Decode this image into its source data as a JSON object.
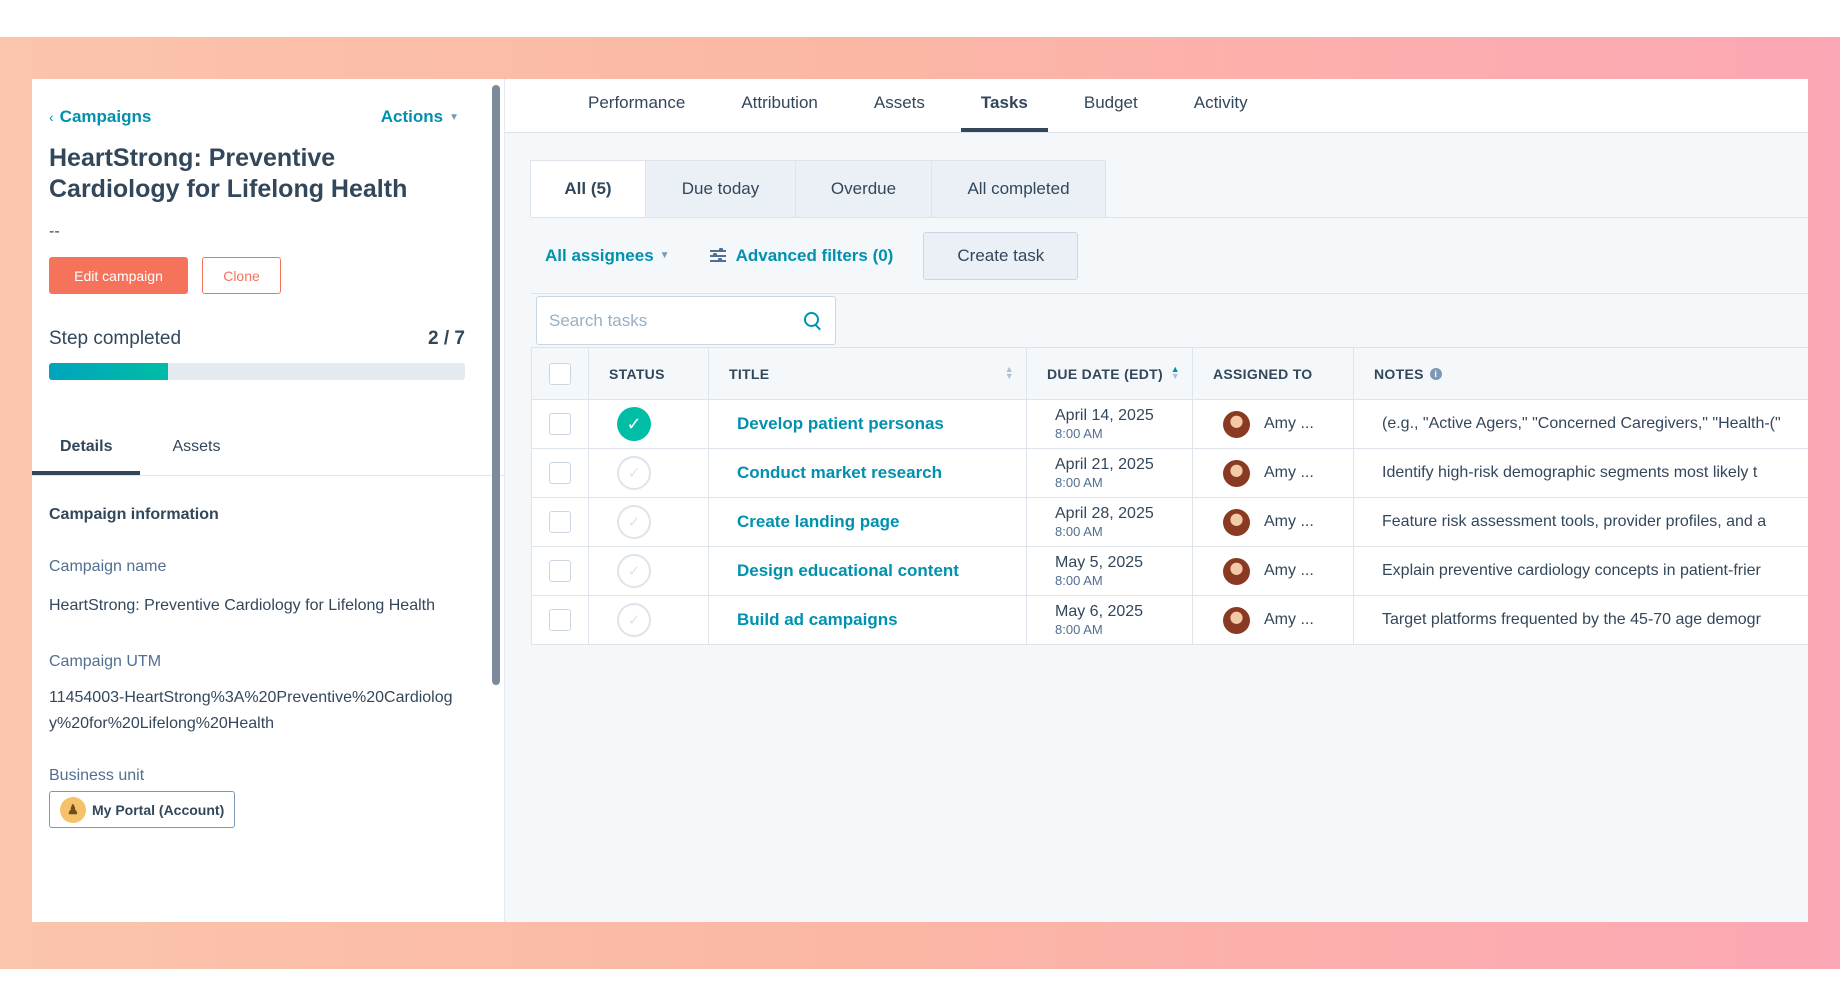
{
  "left_panel": {
    "breadcrumb": "Campaigns",
    "actions_label": "Actions",
    "campaign_title": "HeartStrong: Preventive Cardiology for Lifelong Health",
    "description": "--",
    "edit_button": "Edit campaign",
    "clone_button": "Clone",
    "step_label": "Step completed",
    "step_count": "2 / 7",
    "step_progress_fraction": 0.2857,
    "tabs": [
      {
        "label": "Details",
        "active": true
      },
      {
        "label": "Assets",
        "active": false
      }
    ],
    "section_title": "Campaign information",
    "fields": {
      "name_label": "Campaign name",
      "name_value": "HeartStrong: Preventive Cardiology for Lifelong Health",
      "utm_label": "Campaign UTM",
      "utm_value": "11454003-HeartStrong%3A%20Preventive%20Cardiology%20for%20Lifelong%20Health",
      "business_unit_label": "Business unit",
      "business_unit_value": "My Portal (Account)"
    }
  },
  "top_tabs": [
    {
      "label": "Performance",
      "active": false
    },
    {
      "label": "Attribution",
      "active": false
    },
    {
      "label": "Assets",
      "active": false
    },
    {
      "label": "Tasks",
      "active": true
    },
    {
      "label": "Budget",
      "active": false
    },
    {
      "label": "Activity",
      "active": false
    }
  ],
  "sub_tabs": [
    {
      "label": "All (5)",
      "active": true
    },
    {
      "label": "Due today",
      "active": false
    },
    {
      "label": "Overdue",
      "active": false
    },
    {
      "label": "All completed",
      "active": false
    }
  ],
  "filters": {
    "assignees": "All assignees",
    "advanced": "Advanced filters (0)",
    "create_task": "Create task"
  },
  "search": {
    "placeholder": "Search tasks"
  },
  "table": {
    "headers": {
      "status": "STATUS",
      "title": "TITLE",
      "due_date": "DUE DATE (EDT)",
      "assigned_to": "ASSIGNED TO",
      "notes": "NOTES"
    },
    "rows": [
      {
        "completed": true,
        "title": "Develop patient personas",
        "due_date": "April 14, 2025",
        "due_time": "8:00 AM",
        "assignee": "Amy ...",
        "notes": "(e.g., \"Active Agers,\" \"Concerned Caregivers,\" \"Health-(\""
      },
      {
        "completed": false,
        "title": "Conduct market research",
        "due_date": "April 21, 2025",
        "due_time": "8:00 AM",
        "assignee": "Amy ...",
        "notes": "Identify high-risk demographic segments most likely t"
      },
      {
        "completed": false,
        "title": "Create landing page",
        "due_date": "April 28, 2025",
        "due_time": "8:00 AM",
        "assignee": "Amy ...",
        "notes": "Feature risk assessment tools, provider profiles, and a"
      },
      {
        "completed": false,
        "title": "Design educational content",
        "due_date": "May 5, 2025",
        "due_time": "8:00 AM",
        "assignee": "Amy ...",
        "notes": "Explain preventive cardiology concepts in patient-frier"
      },
      {
        "completed": false,
        "title": "Build ad campaigns",
        "due_date": "May 6, 2025",
        "due_time": "8:00 AM",
        "assignee": "Amy ...",
        "notes": "Target platforms frequented by the 45-70 age demogr"
      }
    ]
  },
  "colors": {
    "accent": "#0091ae",
    "primary_button": "#f5725b",
    "completed": "#00bda5",
    "text": "#33475b"
  }
}
